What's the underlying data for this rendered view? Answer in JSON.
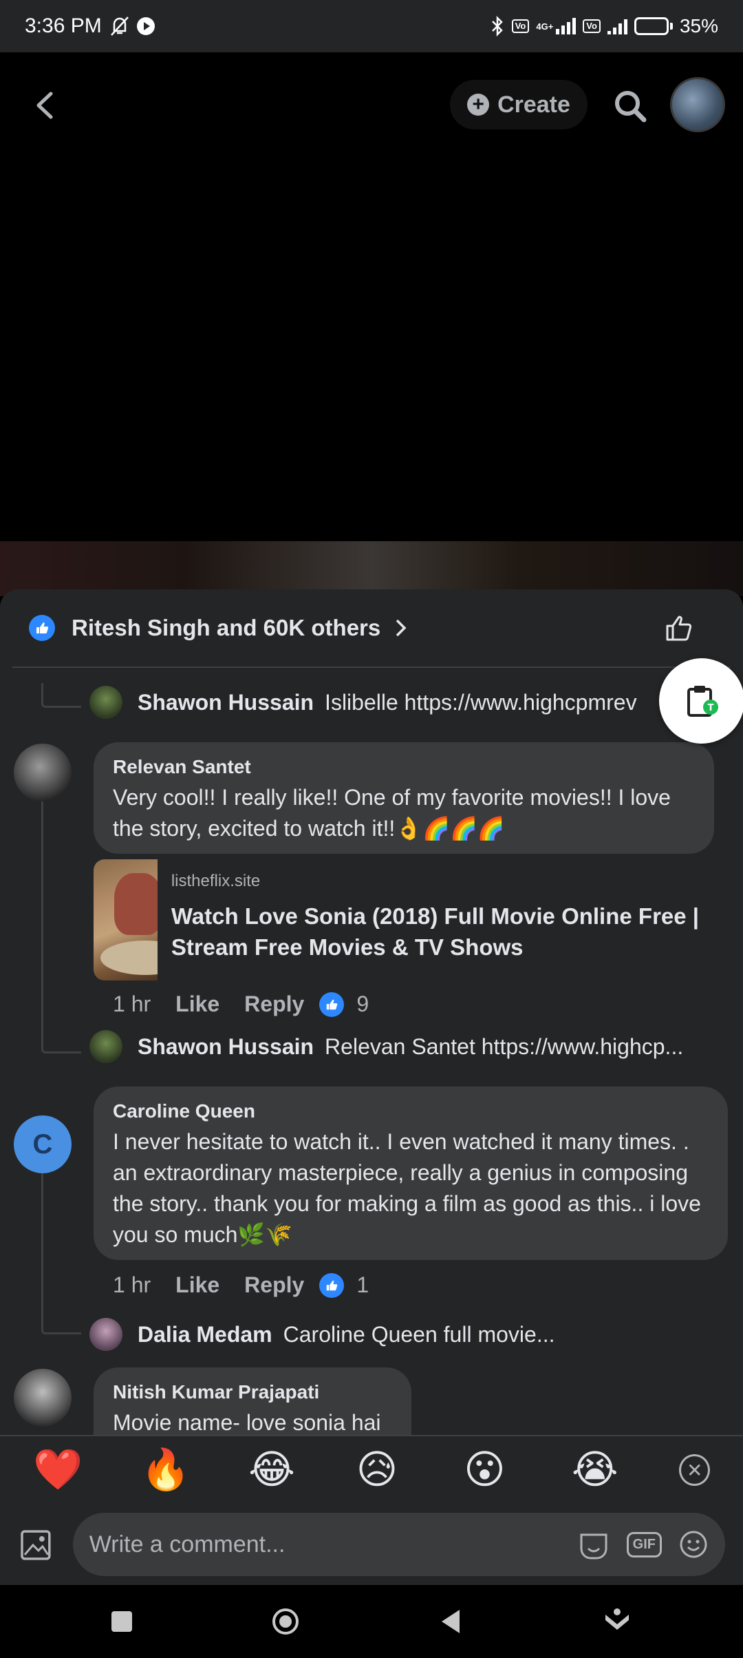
{
  "status_bar": {
    "time": "3:36 PM",
    "network": "4G+",
    "battery": "35%",
    "battery_level": 0.35
  },
  "top_bar": {
    "create_label": "Create"
  },
  "sheet": {
    "reactions_summary": "Ritesh Singh and 60K others"
  },
  "comments": [
    {
      "type": "reply",
      "name": "Shawon Hussain",
      "text": "Islibelle https://www.highcpmrev"
    },
    {
      "type": "comment",
      "name": "Relevan Santet",
      "text": "Very cool!! I really like!! One of my favorite movies!! I love the story, excited to watch it!!👌🌈🌈🌈",
      "link": {
        "domain": "listheflix.site",
        "title": "Watch Love Sonia (2018) Full Movie Online Free | Stream Free Movies & TV Shows"
      },
      "time": "1 hr",
      "like_label": "Like",
      "reply_label": "Reply",
      "reaction_count": "9"
    },
    {
      "type": "reply",
      "name": "Shawon Hussain",
      "text": "Relevan Santet https://www.highcp..."
    },
    {
      "type": "comment",
      "name": "Caroline Queen",
      "avatar_letter": "C",
      "text": "I never hesitate to watch it.. I even watched it many times. . an extraordinary masterpiece, really a genius in composing the story.. thank you for making a film as good as this.. i love you so much🌿🌾",
      "time": "1 hr",
      "like_label": "Like",
      "reply_label": "Reply",
      "reaction_count": "1"
    },
    {
      "type": "reply",
      "name": "Dalia Medam",
      "text": "Caroline Queen full movie..."
    },
    {
      "type": "comment",
      "name": "Nitish Kumar Prajapati",
      "text": "Movie name- love sonia hai"
    }
  ],
  "quick_reactions": [
    "❤️",
    "🔥",
    "😂",
    "😥",
    "😮",
    "😭"
  ],
  "composer": {
    "placeholder": "Write a comment...",
    "gif_label": "GIF"
  },
  "colors": {
    "background": "#242526",
    "bubble": "#3a3b3c",
    "accent": "#2d88ff",
    "text": "#e4e6eb",
    "muted": "#b0b3b8"
  }
}
